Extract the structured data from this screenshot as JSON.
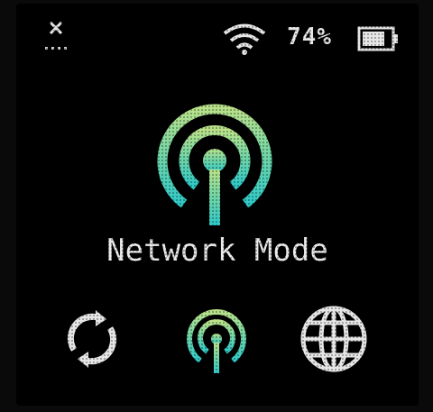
{
  "screen": {
    "title": "Network Mode"
  },
  "status_bar": {
    "signal_icon": "no-signal-icon",
    "wifi_icon": "wifi-icon",
    "battery_percent": "74%",
    "battery_icon": "battery-icon",
    "battery_level": 0.74
  },
  "hero_icon": "broadcast-antenna-icon",
  "menu": {
    "items": [
      {
        "icon": "refresh-icon",
        "selected": false
      },
      {
        "icon": "broadcast-antenna-icon",
        "selected": true
      },
      {
        "icon": "globe-icon",
        "selected": false
      }
    ]
  },
  "colors": {
    "text": "#eaeaea",
    "accent_top": "#b9e28a",
    "accent_mid": "#6fd6a8",
    "accent_bottom": "#2fc9c8",
    "background": "#000000"
  }
}
